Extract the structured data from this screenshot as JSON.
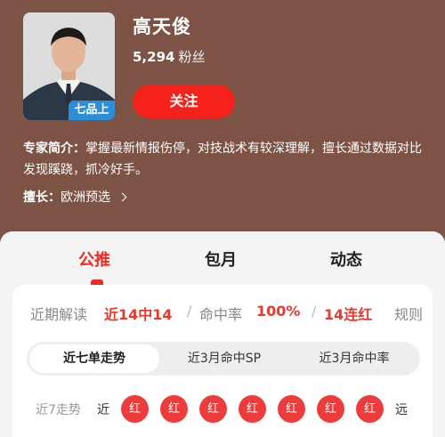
{
  "expert": {
    "name": "高天俊",
    "fans_count": "5,294",
    "fans_unit": "粉丝",
    "rank_badge": "七品上",
    "follow_label": "关注",
    "intro_label": "专家简介：",
    "intro_text": "掌握最新情报伤停，对技战术有较深理解，擅长通过数据对比发现蹊跷，抓冷好手。",
    "specialty_label": "擅长：",
    "specialty_value": "欧洲预选"
  },
  "tabs": [
    {
      "label": "公推",
      "active": true
    },
    {
      "label": "包月",
      "active": false
    },
    {
      "label": "动态",
      "active": false
    }
  ],
  "stats": {
    "recent_label": "近期解读",
    "recent_value": "近14中14",
    "hit_rate_label": "命中率",
    "hit_rate_value": "100%",
    "streak_value": "14连红",
    "rules_label": "规则"
  },
  "segments": [
    {
      "label": "近七单走势",
      "active": true
    },
    {
      "label": "近3月命中SP",
      "active": false
    },
    {
      "label": "近3月命中率",
      "active": false
    }
  ],
  "trend": {
    "label": "近7走势",
    "near_label": "近",
    "far_label": "远",
    "results": [
      "红",
      "红",
      "红",
      "红",
      "红",
      "红",
      "红"
    ]
  },
  "colors": {
    "header_bg": "#7d5346",
    "accent_red": "#ef2a25",
    "badge_blue": "#2a8fd8"
  }
}
